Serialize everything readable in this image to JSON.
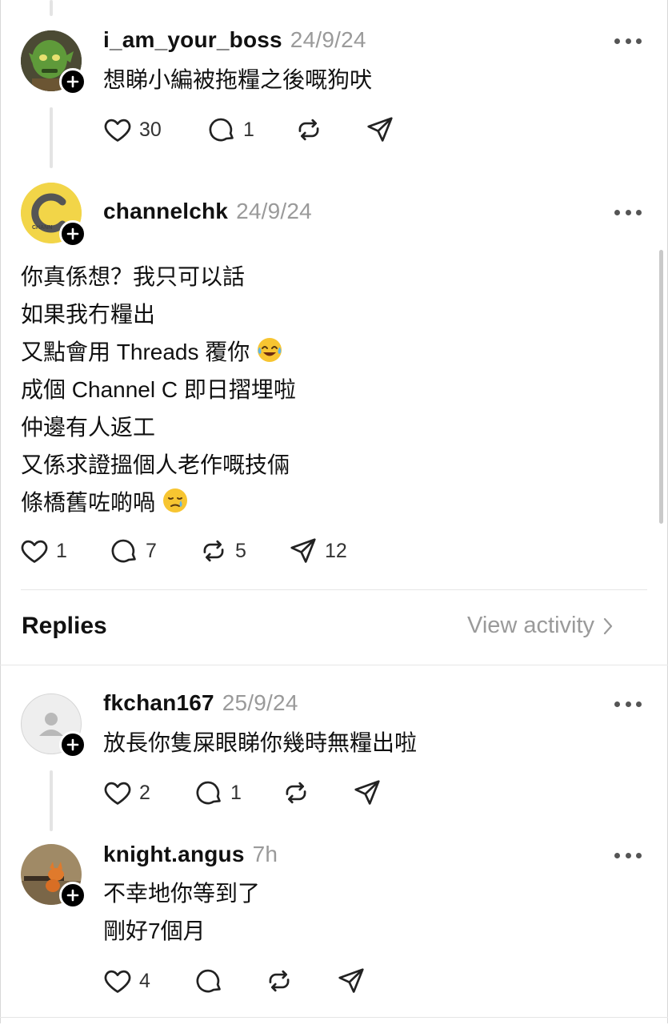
{
  "comment1": {
    "username": "i_am_your_boss",
    "date": "24/9/24",
    "text": "想睇小編被拖糧之後嘅狗吠",
    "likes": "30",
    "replies": "1"
  },
  "post": {
    "username": "channelchk",
    "date": "24/9/24",
    "avatar_text": "CHANN",
    "lines": [
      "你真係想？我只可以話",
      "如果我冇糧出",
      "又點會用 Threads 覆你",
      "成個 Channel C 即日摺埋啦",
      "仲邊有人返工",
      "又係求證搵個人老作嘅技倆",
      "條橋舊咗啲喎"
    ],
    "likes": "1",
    "replies": "7",
    "reposts": "5",
    "shares": "12"
  },
  "replies_header": {
    "title": "Replies",
    "view_activity": "View activity"
  },
  "reply1": {
    "username": "fkchan167",
    "date": "25/9/24",
    "text": "放長你隻屎眼睇你幾時無糧出啦",
    "likes": "2",
    "replies": "1"
  },
  "reply2": {
    "username": "knight.angus",
    "date": "7h",
    "lines": [
      "不幸地你等到了",
      "剛好7個月"
    ],
    "likes": "4"
  },
  "colors": {
    "text": "#111111",
    "muted": "#9a9a9a",
    "divider": "#e6e6e6",
    "channel_avatar": "#f2d548"
  },
  "icons": {
    "like": "heart-icon",
    "reply": "comment-bubble-icon",
    "repost": "repost-arrows-icon",
    "share": "paper-plane-icon",
    "more": "more-dots-icon",
    "follow": "plus-icon",
    "chevron": "chevron-right-icon"
  }
}
